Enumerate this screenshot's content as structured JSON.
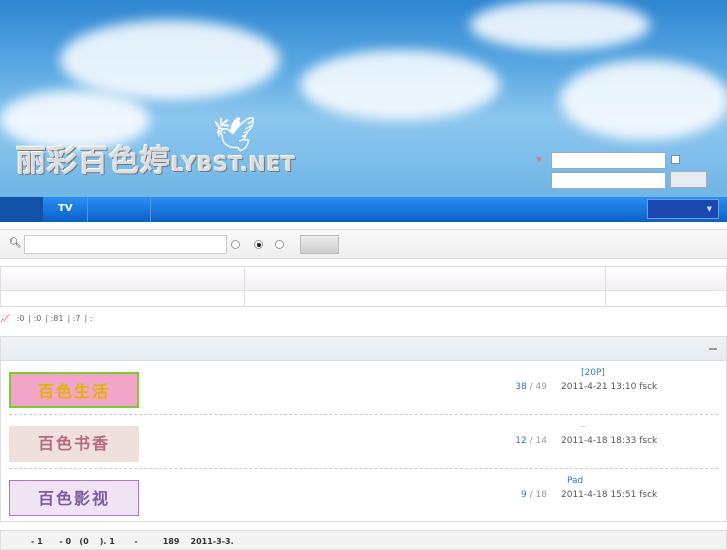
{
  "header": {
    "logo_text": "丽彩百色婷",
    "logo_domain": "LYBST.NET"
  },
  "nav": {
    "items": [
      "TV"
    ]
  },
  "search": {
    "value": "",
    "placeholder": ""
  },
  "stats": {
    "items": [
      ":0",
      ":0",
      ":81",
      ":7",
      ":"
    ]
  },
  "forums": [
    {
      "logo_text": "百色生活",
      "topics": "38",
      "posts": "49",
      "last_title": "[20P]",
      "last_time": "2011-4-21 13:10 fsck"
    },
    {
      "logo_text": "百色书香",
      "topics": "12",
      "posts": "14",
      "last_title": "...",
      "last_time": "2011-4-18 18:33 fsck"
    },
    {
      "logo_text": "百色影视",
      "topics": "9",
      "posts": "18",
      "last_title": "Pad",
      "last_time": "2011-4-18 15:51 fsck"
    }
  ],
  "footer": {
    "text": "- 1      - 0   (0    ). 1       -         189    2011-3-3."
  }
}
